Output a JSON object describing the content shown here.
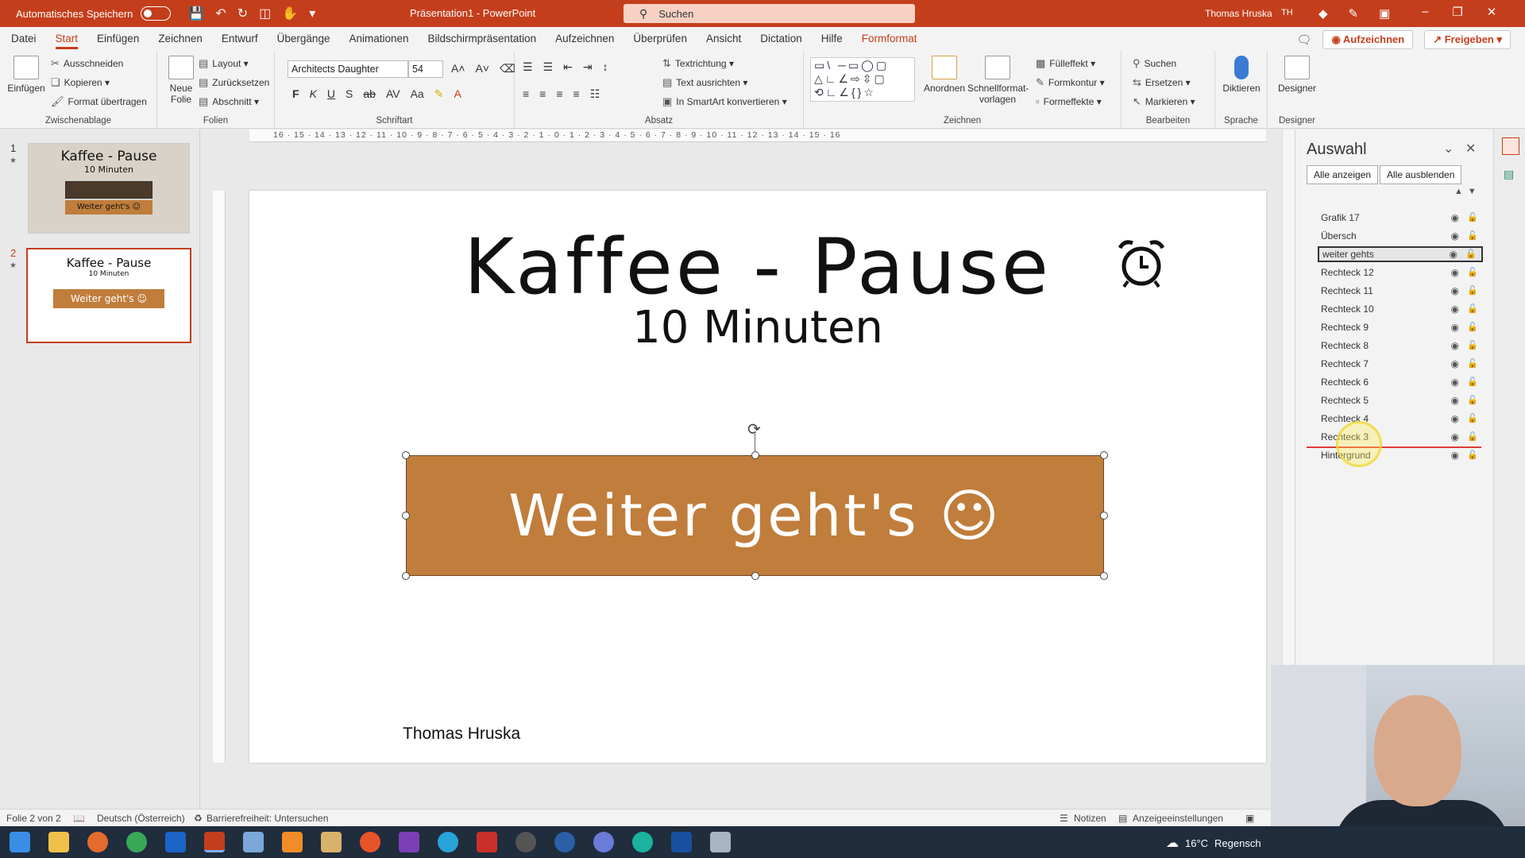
{
  "titlebar": {
    "autosave_label": "Automatisches Speichern",
    "doc_title": "Präsentation1 - PowerPoint",
    "search_placeholder": "Suchen",
    "user_name": "Thomas Hruska",
    "user_initials": "TH"
  },
  "tabs": [
    "Datei",
    "Start",
    "Einfügen",
    "Zeichnen",
    "Entwurf",
    "Übergänge",
    "Animationen",
    "Bildschirmpräsentation",
    "Aufzeichnen",
    "Überprüfen",
    "Ansicht",
    "Dictation",
    "Hilfe",
    "Formformat"
  ],
  "active_tab": "Start",
  "tab_actions": {
    "record": "Aufzeichnen",
    "share": "Freigeben"
  },
  "ribbon": {
    "clipboard": {
      "label": "Zwischenablage",
      "paste": "Einfügen",
      "cut": "Ausschneiden",
      "copy": "Kopieren",
      "format_painter": "Format übertragen"
    },
    "slides": {
      "label": "Folien",
      "new_slide": "Neue Folie",
      "layout": "Layout",
      "reset": "Zurücksetzen",
      "section": "Abschnitt"
    },
    "font": {
      "label": "Schriftart",
      "font_name": "Architects Daughter",
      "font_size": "54"
    },
    "paragraph": {
      "label": "Absatz",
      "text_direction": "Textrichtung",
      "align_text": "Text ausrichten",
      "smartart": "In SmartArt konvertieren"
    },
    "drawing": {
      "label": "Zeichnen",
      "arrange": "Anordnen",
      "quick_styles": "Schnellformat-vorlagen",
      "fill": "Fülleffekt",
      "outline": "Formkontur",
      "effects": "Formeffekte"
    },
    "editing": {
      "label": "Bearbeiten",
      "find": "Suchen",
      "replace": "Ersetzen",
      "select": "Markieren"
    },
    "voice": {
      "label": "Sprache",
      "dictate": "Diktieren"
    },
    "designer": {
      "label": "Designer",
      "designer": "Designer"
    }
  },
  "thumbnails": [
    {
      "num": "1",
      "title": "Kaffee - Pause",
      "sub": "10 Minuten",
      "button": "Weiter geht's ☺"
    },
    {
      "num": "2",
      "title": "Kaffee - Pause",
      "sub": "10 Minuten",
      "button": "Weiter geht's ☺"
    }
  ],
  "slide": {
    "title": "Kaffee - Pause",
    "subtitle": "10 Minuten",
    "button_text": "Weiter geht's ☺",
    "author": "Thomas Hruska"
  },
  "selection_pane": {
    "title": "Auswahl",
    "show_all": "Alle anzeigen",
    "hide_all": "Alle ausblenden",
    "layers": [
      "Grafik 17",
      "Übersch",
      "weiter gehts",
      "Rechteck 12",
      "Rechteck 11",
      "Rechteck 10",
      "Rechteck 9",
      "Rechteck 8",
      "Rechteck 7",
      "Rechteck 6",
      "Rechteck 5",
      "Rechteck 4",
      "Rechteck 3",
      "Hintergrund"
    ],
    "selected_layer": "weiter gehts"
  },
  "statusbar": {
    "slide_info": "Folie 2 von 2",
    "language": "Deutsch (Österreich)",
    "accessibility": "Barrierefreiheit: Untersuchen",
    "notes": "Notizen",
    "display_settings": "Anzeigeeinstellungen"
  },
  "taskbar": {
    "temperature": "16°C",
    "weather": "Regensch"
  },
  "colors": {
    "accent": "#c43e1c",
    "button_fill": "#c07d3b"
  }
}
